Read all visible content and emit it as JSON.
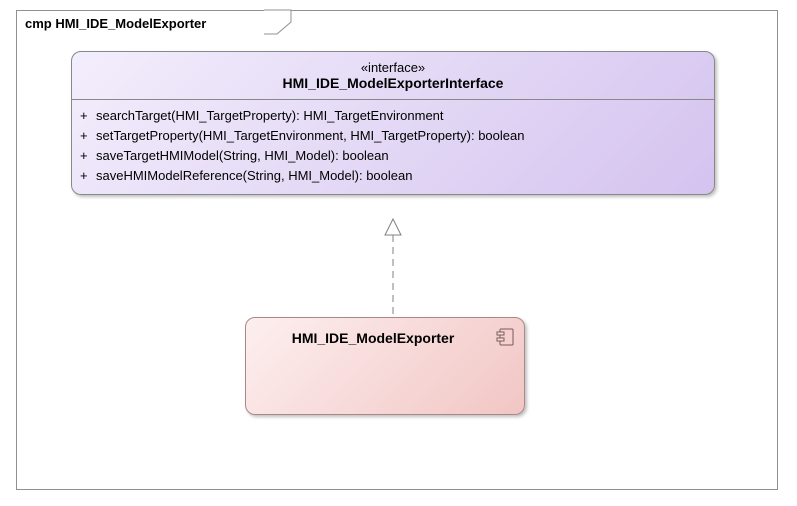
{
  "diagram": {
    "title": "cmp HMI_IDE_ModelExporter"
  },
  "interface": {
    "stereotype": "«interface»",
    "name": "HMI_IDE_ModelExporterInterface",
    "operations": [
      {
        "visibility": "+",
        "signature": "searchTarget(HMI_TargetProperty): HMI_TargetEnvironment"
      },
      {
        "visibility": "+",
        "signature": "setTargetProperty(HMI_TargetEnvironment, HMI_TargetProperty): boolean"
      },
      {
        "visibility": "+",
        "signature": "saveTargetHMIModel(String, HMI_Model): boolean"
      },
      {
        "visibility": "+",
        "signature": "saveHMIModelReference(String, HMI_Model): boolean"
      }
    ]
  },
  "component": {
    "name": "HMI_IDE_ModelExporter"
  },
  "relationship": {
    "type": "realization",
    "from": "HMI_IDE_ModelExporter",
    "to": "HMI_IDE_ModelExporterInterface"
  }
}
